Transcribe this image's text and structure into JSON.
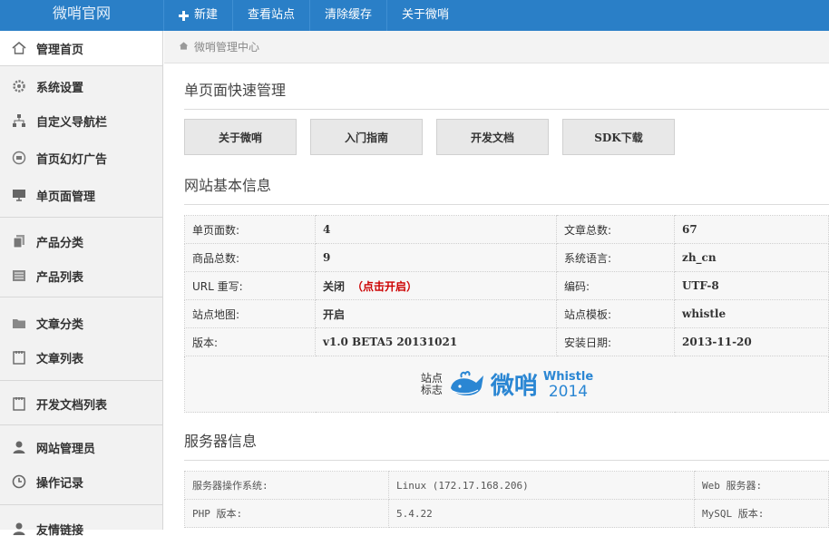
{
  "brand": "微哨官网",
  "topnav": [
    {
      "label": "新建",
      "icon": "plus-icon"
    },
    {
      "label": "查看站点"
    },
    {
      "label": "清除缓存"
    },
    {
      "label": "关于微哨"
    }
  ],
  "sidebar": [
    {
      "label": "管理首页",
      "icon": "home-icon"
    },
    {
      "label": "系统设置",
      "icon": "gear-icon"
    },
    {
      "label": "自定义导航栏",
      "icon": "sitemap-icon"
    },
    {
      "label": "首页幻灯广告",
      "icon": "slideshow-icon"
    },
    {
      "label": "单页面管理",
      "icon": "monitor-icon"
    },
    {
      "label": "产品分类",
      "icon": "copy-icon"
    },
    {
      "label": "产品列表",
      "icon": "list-icon"
    },
    {
      "label": "文章分类",
      "icon": "folder-icon"
    },
    {
      "label": "文章列表",
      "icon": "notebook-icon"
    },
    {
      "label": "开发文档列表",
      "icon": "notebook-icon"
    },
    {
      "label": "网站管理员",
      "icon": "user-icon"
    },
    {
      "label": "操作记录",
      "icon": "clock-icon"
    },
    {
      "label": "友情链接",
      "icon": "link-icon"
    }
  ],
  "breadcrumb": "微哨管理中心",
  "quick": {
    "title": "单页面快速管理",
    "buttons": [
      "关于微哨",
      "入门指南",
      "开发文档",
      "SDK下载"
    ]
  },
  "site_info": {
    "title": "网站基本信息",
    "rows": [
      [
        "单页面数:",
        "4",
        "文章总数:",
        "67"
      ],
      [
        "商品总数:",
        "9",
        "系统语言:",
        "zh_cn"
      ],
      [
        "URL 重写:",
        "关闭",
        "编码:",
        "UTF-8"
      ],
      [
        "站点地图:",
        "开启",
        "站点模板:",
        "whistle"
      ],
      [
        "版本:",
        "v1.0 BETA5 20131021",
        "安装日期:",
        "2013-11-20"
      ]
    ],
    "url_rewrite_action": "（点击开启）",
    "logo_label": "站点标志",
    "logo": {
      "cn": "微哨",
      "en": "Whistle",
      "year": "2014"
    }
  },
  "server_info": {
    "title": "服务器信息",
    "rows": [
      [
        "服务器操作系统:",
        "Linux (172.17.168.206)",
        "Web 服务器:"
      ],
      [
        "PHP 版本:",
        "5.4.22",
        "MySQL 版本:"
      ]
    ]
  },
  "colors": {
    "topbar": "#2a7fc7",
    "accent_red": "#cc0000",
    "logo_blue": "#2a86d3"
  }
}
